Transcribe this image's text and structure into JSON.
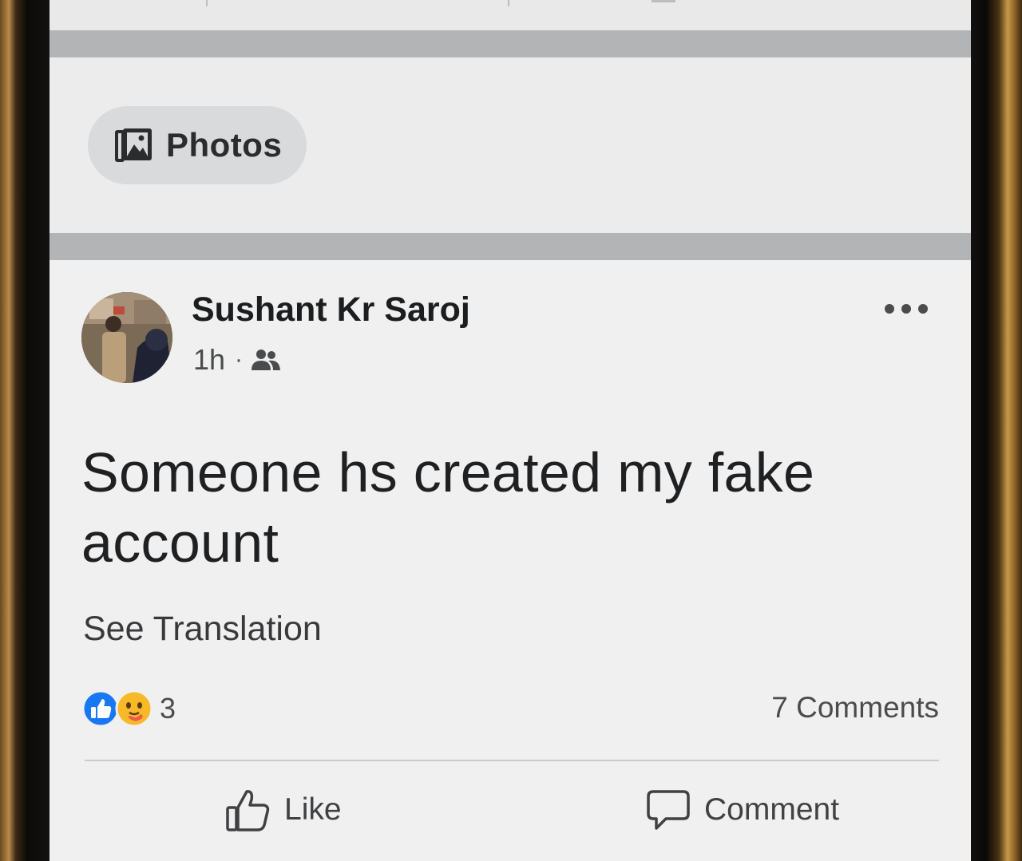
{
  "photos_chip": {
    "label": "Photos",
    "icon": "photo-icon"
  },
  "post": {
    "author": "Sushant Kr Saroj",
    "time": "1h",
    "separator": "·",
    "audience_icon": "friends-icon",
    "more_icon": "more-options-icon",
    "text": "Someone hs created my fake account",
    "see_translation": "See Translation",
    "reactions": {
      "icons": [
        "like-reaction-icon",
        "care-reaction-icon"
      ],
      "count": "3"
    },
    "comments_count": "7 Comments",
    "actions": {
      "like": "Like",
      "comment": "Comment"
    }
  },
  "colors": {
    "like_blue": "#1877f2",
    "care_yellow": "#f7b928",
    "screen_bg": "#ececec",
    "divider": "#b3b4b6"
  }
}
